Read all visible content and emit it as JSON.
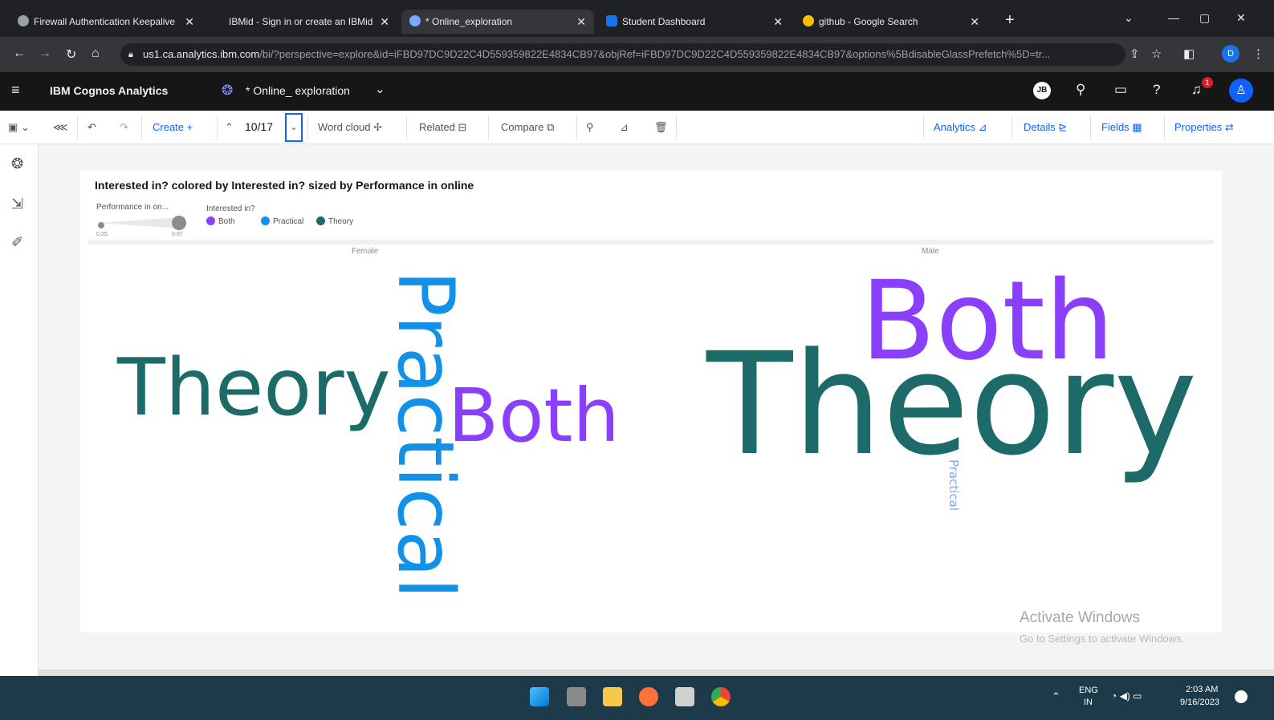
{
  "browser": {
    "tabs": [
      {
        "title": "Firewall Authentication Keepalive",
        "active": false
      },
      {
        "title": "IBMid - Sign in or create an IBMid",
        "active": false
      },
      {
        "title": "* Online_exploration",
        "active": true
      },
      {
        "title": "Student Dashboard",
        "active": false
      },
      {
        "title": "github - Google Search",
        "active": false
      }
    ],
    "url_host": "us1.ca.analytics.ibm.com",
    "url_path": "/bi/?perspective=explore&id=iFBD97DC9D22C4D559359822E4834CB97&objRef=iFBD97DC9D22C4D559359822E4834CB97&options%5BdisableGlassPrefetch%5D=tr...",
    "profile_initial": "D"
  },
  "app": {
    "brand": "IBM Cognos Analytics",
    "exploration_name": "* Online_ exploration",
    "user_badge": "JB",
    "notifications_count": "1"
  },
  "toolbar": {
    "create": "Create",
    "page_indicator": "10/17",
    "word_cloud": "Word cloud",
    "related": "Related",
    "compare": "Compare",
    "analytics": "Analytics",
    "details": "Details",
    "fields": "Fields",
    "properties": "Properties"
  },
  "viz": {
    "title": "Interested in? colored by Interested in? sized by Performance in online",
    "size_legend_title": "Performance in on...",
    "size_min": "0.25",
    "size_max": "0.97",
    "color_legend_title": "Interested in?",
    "legend": [
      {
        "label": "Both",
        "color": "#8a3ffc"
      },
      {
        "label": "Practical",
        "color": "#1192e8"
      },
      {
        "label": "Theory",
        "color": "#1d6b69"
      }
    ],
    "panels": [
      {
        "label": "Female"
      },
      {
        "label": "Male"
      }
    ]
  },
  "chart_data": {
    "type": "word_cloud",
    "title": "Interested in? colored by Interested in? sized by Performance in online",
    "color_by": "Interested in?",
    "size_by": "Performance in online",
    "size_range": [
      0.25,
      0.97
    ],
    "panels": [
      {
        "name": "Female",
        "words": [
          {
            "text": "Theory",
            "category": "Theory",
            "size": 0.6,
            "orientation": "horizontal"
          },
          {
            "text": "Practical",
            "category": "Practical",
            "size": 0.55,
            "orientation": "vertical"
          },
          {
            "text": "Both",
            "category": "Both",
            "size": 0.55,
            "orientation": "horizontal"
          }
        ]
      },
      {
        "name": "Male",
        "words": [
          {
            "text": "Both",
            "category": "Both",
            "size": 0.8,
            "orientation": "horizontal"
          },
          {
            "text": "Theory",
            "category": "Theory",
            "size": 0.97,
            "orientation": "horizontal"
          },
          {
            "text": "Practical",
            "category": "Practical",
            "size": 0.25,
            "orientation": "vertical"
          }
        ]
      }
    ]
  },
  "os": {
    "watermark_line1": "Activate Windows",
    "watermark_line2": "Go to Settings to activate Windows.",
    "lang": "ENG",
    "region": "IN",
    "time": "2:03 AM",
    "date": "9/16/2023"
  }
}
